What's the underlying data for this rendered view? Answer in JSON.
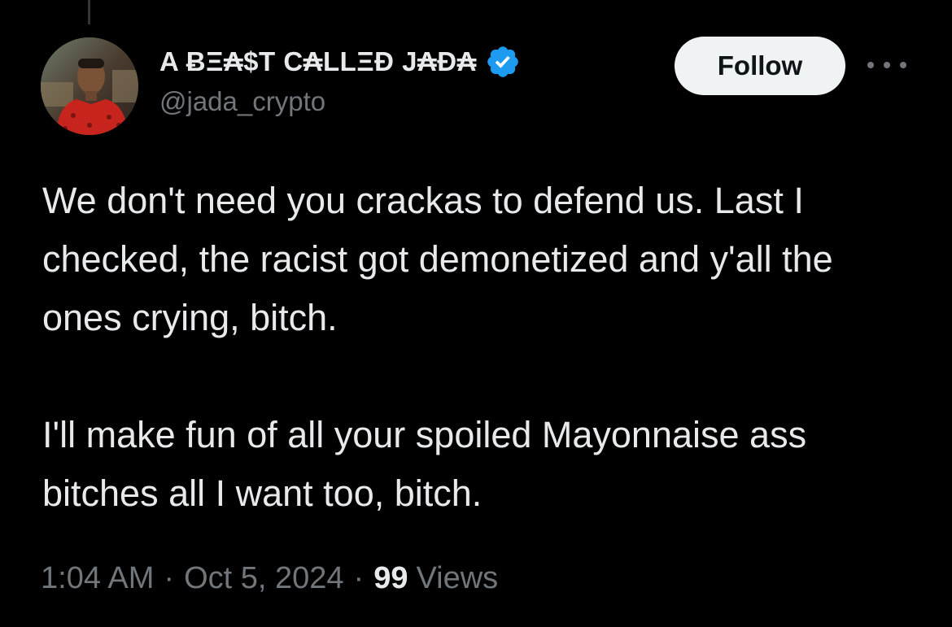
{
  "tweet": {
    "author": {
      "display_name": "A ɃΞ₳$T C₳LLΞĐ J₳Đ₳",
      "handle": "@jada_crypto",
      "verified": true,
      "verified_color": "#1d9bf0",
      "avatar_icon": "profile-photo"
    },
    "follow_label": "Follow",
    "more_icon": "more-horizontal-icon",
    "text_paragraphs": [
      "We don't need you crackas to defend us. Last I checked, the racist got demonetized and y'all the ones crying, bitch.",
      "I'll make fun of all your spoiled Mayonnaise ass bitches all I want too, bitch."
    ],
    "time": "1:04 AM",
    "date": "Oct 5, 2024",
    "separator": "·",
    "views_count": "99",
    "views_label": "Views"
  },
  "colors": {
    "background": "#000000",
    "primary_text": "#e7e9ea",
    "secondary_text": "#71767b",
    "follow_bg": "#eff3f4",
    "follow_text": "#0f1419"
  }
}
